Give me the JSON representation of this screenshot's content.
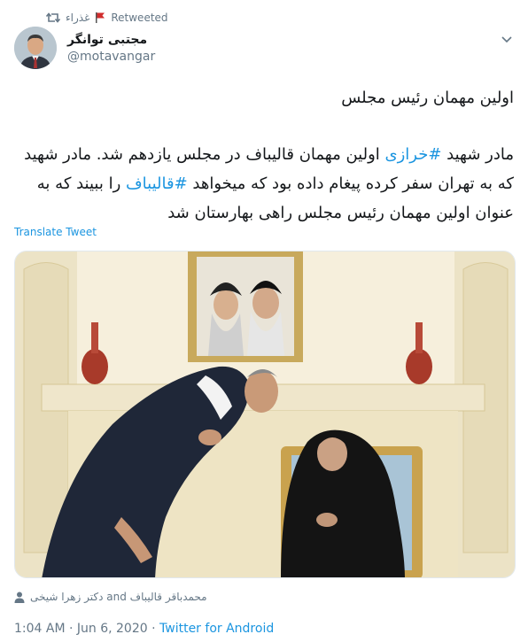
{
  "retweet": {
    "user": "غذراء",
    "label": "Retweeted"
  },
  "author": {
    "name": "مجتبی توانگر",
    "handle": "@motavangar"
  },
  "tweet": {
    "title": "اولین مهمان رئیس مجلس",
    "line1_a": "مادر شهید ",
    "line1_tag": "#خرازی",
    "line1_b": " اولین مهمان قالیباف در مجلس یازدهم شد. مادر شهید",
    "line2_a": "که به تهران سفر کرده پیغام داده بود که میخواهد ",
    "line2_tag": "#قالیباف",
    "line2_b": " را ببیند که به",
    "line3": "عنوان اولین مهمان رئیس مجلس راهی بهارستان شد",
    "translate": "Translate Tweet"
  },
  "tagged": {
    "names": "محمدباقر قالیباف and دکتر زهرا شیخی"
  },
  "meta": {
    "time": "1:04 AM · Jun 6, 2020 · ",
    "source": "Twitter for Android"
  },
  "colors": {
    "link": "#1b95e0",
    "muted": "#657786",
    "text": "#14171a"
  },
  "icons": [
    "retweet-icon",
    "flag-icon",
    "chevron-down-icon",
    "person-icon"
  ]
}
